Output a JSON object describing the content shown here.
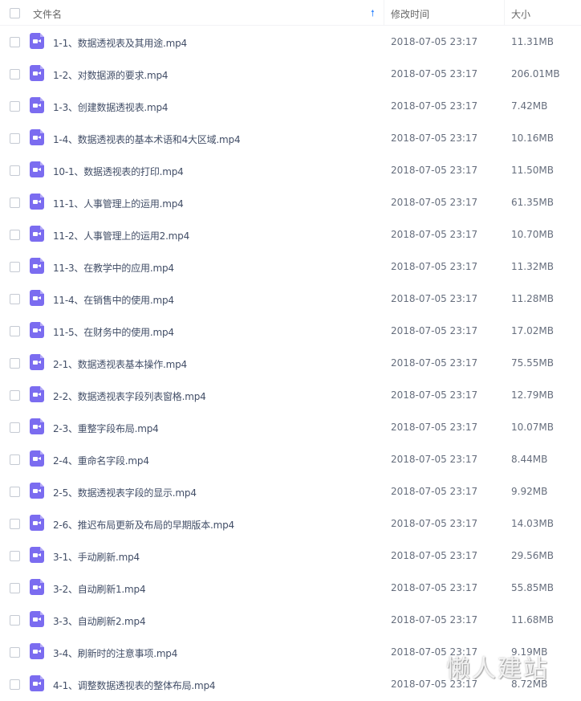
{
  "header": {
    "name_label": "文件名",
    "sort_icon": "sort-asc-arrow",
    "time_label": "修改时间",
    "size_label": "大小"
  },
  "files": [
    {
      "name": "1-1、数据透视表及其用途.mp4",
      "time": "2018-07-05 23:17",
      "size": "11.31MB"
    },
    {
      "name": "1-2、对数据源的要求.mp4",
      "time": "2018-07-05 23:17",
      "size": "206.01MB"
    },
    {
      "name": "1-3、创建数据透视表.mp4",
      "time": "2018-07-05 23:17",
      "size": "7.42MB"
    },
    {
      "name": "1-4、数据透视表的基本术语和4大区域.mp4",
      "time": "2018-07-05 23:17",
      "size": "10.16MB"
    },
    {
      "name": "10-1、数据透视表的打印.mp4",
      "time": "2018-07-05 23:17",
      "size": "11.50MB"
    },
    {
      "name": "11-1、人事管理上的运用.mp4",
      "time": "2018-07-05 23:17",
      "size": "61.35MB"
    },
    {
      "name": "11-2、人事管理上的运用2.mp4",
      "time": "2018-07-05 23:17",
      "size": "10.70MB"
    },
    {
      "name": "11-3、在教学中的应用.mp4",
      "time": "2018-07-05 23:17",
      "size": "11.32MB"
    },
    {
      "name": "11-4、在销售中的使用.mp4",
      "time": "2018-07-05 23:17",
      "size": "11.28MB"
    },
    {
      "name": "11-5、在财务中的使用.mp4",
      "time": "2018-07-05 23:17",
      "size": "17.02MB"
    },
    {
      "name": "2-1、数据透视表基本操作.mp4",
      "time": "2018-07-05 23:17",
      "size": "75.55MB"
    },
    {
      "name": "2-2、数据透视表字段列表窗格.mp4",
      "time": "2018-07-05 23:17",
      "size": "12.79MB"
    },
    {
      "name": "2-3、重整字段布局.mp4",
      "time": "2018-07-05 23:17",
      "size": "10.07MB"
    },
    {
      "name": "2-4、重命名字段.mp4",
      "time": "2018-07-05 23:17",
      "size": "8.44MB"
    },
    {
      "name": "2-5、数据透视表字段的显示.mp4",
      "time": "2018-07-05 23:17",
      "size": "9.92MB"
    },
    {
      "name": "2-6、推迟布局更新及布局的早期版本.mp4",
      "time": "2018-07-05 23:17",
      "size": "14.03MB"
    },
    {
      "name": "3-1、手动刷新.mp4",
      "time": "2018-07-05 23:17",
      "size": "29.56MB"
    },
    {
      "name": "3-2、自动刷新1.mp4",
      "time": "2018-07-05 23:17",
      "size": "55.85MB"
    },
    {
      "name": "3-3、自动刷新2.mp4",
      "time": "2018-07-05 23:17",
      "size": "11.68MB"
    },
    {
      "name": "3-4、刷新时的注意事项.mp4",
      "time": "2018-07-05 23:17",
      "size": "9.19MB"
    },
    {
      "name": "4-1、调整数据透视表的整体布局.mp4",
      "time": "2018-07-05 23:17",
      "size": "8.72MB"
    }
  ],
  "watermark": "懒人建站",
  "colors": {
    "file_icon": "#7b6cf0",
    "sort_arrow": "#3b8cff"
  }
}
